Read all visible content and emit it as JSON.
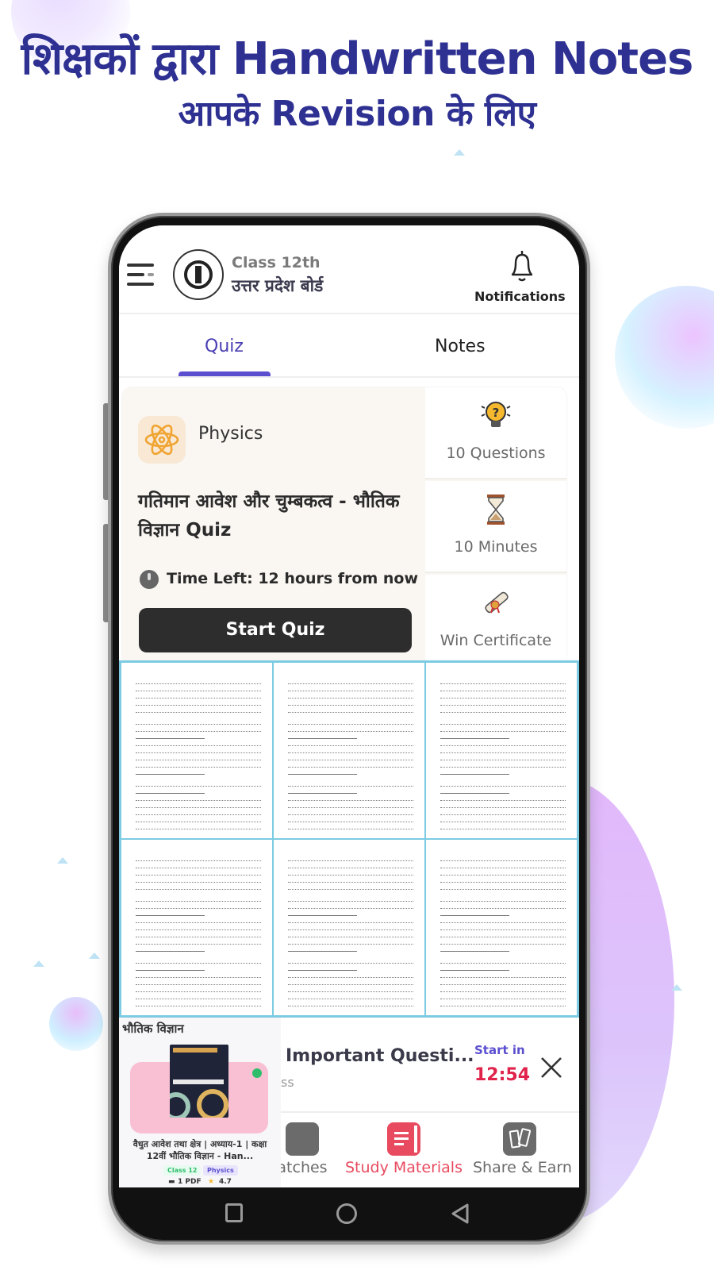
{
  "headline": {
    "line1": "शिक्षकों द्वारा Handwritten Notes",
    "line2": "आपके Revision के लिए",
    "color": "#2e3192"
  },
  "header": {
    "class_label": "Class 12th",
    "board_label": "उत्तर प्रदेश बोर्ड",
    "notifications_label": "Notifications",
    "menu_icon": "hamburger-menu-icon",
    "logo": "up-board-logo",
    "bell_icon": "bell-icon"
  },
  "tabs": [
    {
      "label": "Quiz",
      "active": true
    },
    {
      "label": "Notes",
      "active": false
    }
  ],
  "quiz_card": {
    "subject": "Physics",
    "subject_icon": "atom-icon",
    "title": "गतिमान आवेश और चुम्बकत्व - भौतिक विज्ञान Quiz",
    "time_left": "Time Left: 12 hours from now",
    "start_button": "Start Quiz",
    "stats": [
      {
        "icon": "lightbulb-question-icon",
        "label": "10 Questions"
      },
      {
        "icon": "hourglass-icon",
        "label": "10 Minutes"
      },
      {
        "icon": "certificate-scroll-icon",
        "label": "Win Certificate"
      }
    ]
  },
  "notes_grid": {
    "page_count": 6,
    "thumbnail": "handwritten-notes-page"
  },
  "mini_card": {
    "title": "भौतिक विज्ञान",
    "description": "वैधुत आवेश तथा क्षेत्र | अध्याय-1 | कक्षा 12वीं भौतिक विज्ञान - Han...",
    "tag_class": "Class 12",
    "tag_subject": "Physics",
    "pdf_count": "1 PDF",
    "rating": "4.7"
  },
  "live_banner": {
    "title": "Important Questi...",
    "subtitle": "ss",
    "start_in_label": "Start in",
    "countdown": "12:54",
    "countdown_color": "#e0234a"
  },
  "bottom_nav": [
    {
      "label": "atches",
      "icon": "batches-icon",
      "active": false
    },
    {
      "label": "Study Materials",
      "icon": "study-materials-icon",
      "active": true
    },
    {
      "label": "Share & Earn",
      "icon": "share-earn-icon",
      "active": false
    }
  ],
  "colors": {
    "accent": "#5b4fd0",
    "active_nav": "#e84a5f",
    "inactive_nav": "#6b6b6b",
    "grid_border": "#7ccbe2"
  }
}
